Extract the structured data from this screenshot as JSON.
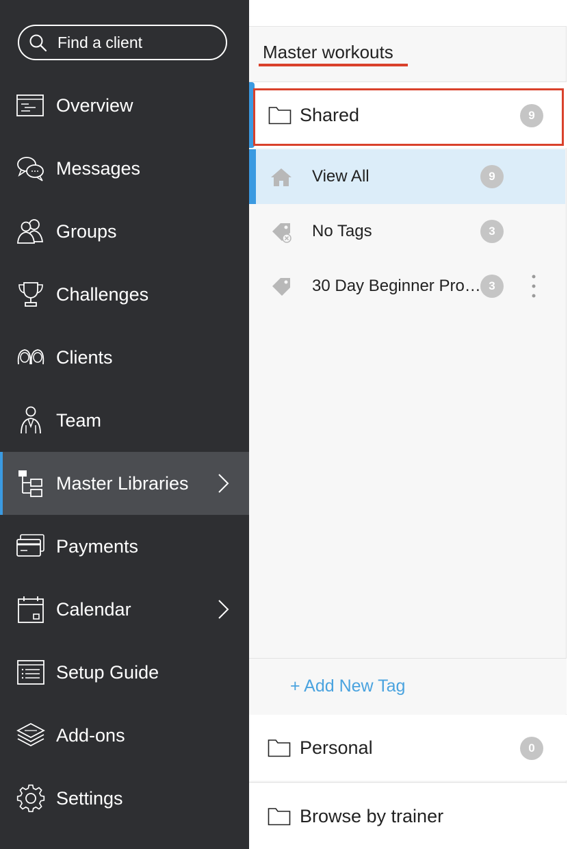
{
  "search": {
    "placeholder": "Find a client"
  },
  "sidebar": {
    "items": [
      {
        "label": "Overview",
        "icon": "overview-icon"
      },
      {
        "label": "Messages",
        "icon": "messages-icon"
      },
      {
        "label": "Groups",
        "icon": "groups-icon"
      },
      {
        "label": "Challenges",
        "icon": "trophy-icon"
      },
      {
        "label": "Clients",
        "icon": "clients-icon"
      },
      {
        "label": "Team",
        "icon": "team-icon"
      },
      {
        "label": "Master Libraries",
        "icon": "hierarchy-icon",
        "active": true,
        "chevron": true
      },
      {
        "label": "Payments",
        "icon": "credit-card-icon"
      },
      {
        "label": "Calendar",
        "icon": "calendar-icon",
        "chevron": true
      },
      {
        "label": "Setup Guide",
        "icon": "list-icon"
      },
      {
        "label": "Add-ons",
        "icon": "layers-icon"
      },
      {
        "label": "Settings",
        "icon": "gear-icon"
      }
    ]
  },
  "panel": {
    "title": "Master workouts",
    "folders": {
      "shared": {
        "label": "Shared",
        "count": "9"
      },
      "personal": {
        "label": "Personal",
        "count": "0"
      },
      "browse": {
        "label": "Browse by trainer"
      }
    },
    "tags": [
      {
        "label": "View All",
        "count": "9",
        "icon": "home-icon",
        "selected": true
      },
      {
        "label": "No Tags",
        "count": "3",
        "icon": "tag-x-icon"
      },
      {
        "label": "30 Day Beginner Pro…",
        "count": "3",
        "icon": "tag-icon",
        "menu": true
      }
    ],
    "add_tag": "+ Add New Tag"
  },
  "colors": {
    "sidebar_bg": "#2e2f32",
    "sidebar_active_bg": "#4b4d51",
    "accent_blue": "#3b9ae1",
    "highlight_red": "#d9412b",
    "selected_row_bg": "#dcedf9",
    "link_blue": "#4aa3df",
    "badge_gray": "#c5c5c5"
  }
}
